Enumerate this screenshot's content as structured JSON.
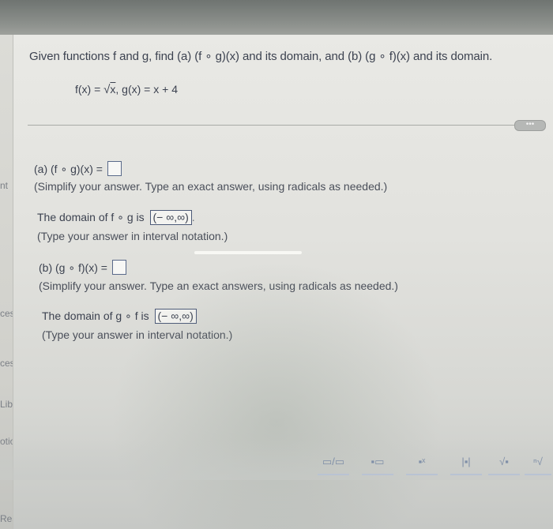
{
  "question": {
    "prompt": "Given functions f and g, find (a) (f ∘ g)(x) and its domain, and (b) (g ∘ f)(x) and its domain.",
    "f_prefix": "f(x) = ",
    "sqrt_symbol": "√",
    "sqrt_argument": "x",
    "g_def": ", g(x) = x + 4"
  },
  "more_button": "•••",
  "part_a": {
    "label": "(a) (f ∘ g)(x) =",
    "instruction": "(Simplify your answer. Type an exact answer, using radicals as needed.)",
    "domain_label": "The domain of f ∘ g is",
    "domain_value": "(− ∞,∞)",
    "domain_instruction": "(Type your answer in interval notation.)"
  },
  "part_b": {
    "label": "(b) (g ∘ f)(x) =",
    "instruction": "(Simplify your answer. Type an exact answers, using radicals as needed.)",
    "domain_label": "The domain of g ∘ f is",
    "domain_value": "(− ∞,∞)",
    "domain_instruction": "(Type your answer in interval notation.)"
  },
  "sidebar": {
    "items": [
      "nt",
      "cess",
      "ces",
      "Libr",
      "otion",
      "Resou"
    ]
  },
  "toolbar": {
    "tools": [
      {
        "icon": "fraction-icon",
        "glyph": "▭/▭"
      },
      {
        "icon": "mixed-number-icon",
        "glyph": "▪▭"
      },
      {
        "icon": "exponent-icon",
        "glyph": "▪ˣ"
      },
      {
        "icon": "absolute-value-icon",
        "glyph": "|▪|"
      },
      {
        "icon": "square-root-icon",
        "glyph": "√▪"
      },
      {
        "icon": "nth-root-icon",
        "glyph": "ⁿ√"
      }
    ]
  }
}
